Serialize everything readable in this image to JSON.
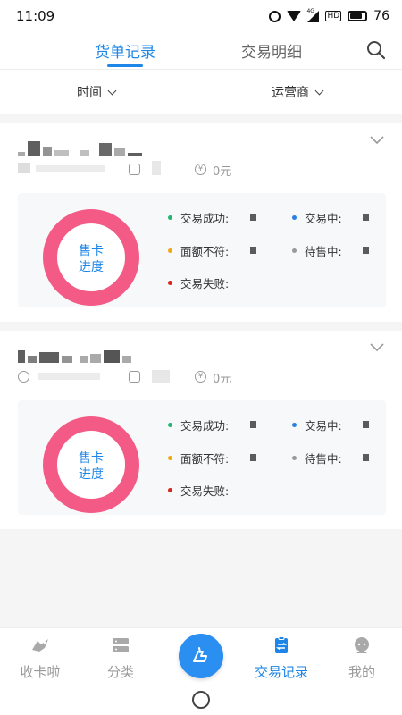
{
  "status_bar": {
    "time": "11:09",
    "network": "4G",
    "battery": "76"
  },
  "tabs": [
    {
      "label": "货单记录",
      "active": true
    },
    {
      "label": "交易明细",
      "active": false
    }
  ],
  "filters": {
    "time_label": "时间",
    "operator_label": "运营商"
  },
  "cards": [
    {
      "amount": "0元",
      "ring_label_line1": "售卡",
      "ring_label_line2": "进度",
      "stats": {
        "success": "交易成功:",
        "in_progress": "交易中:",
        "mismatch": "面额不符:",
        "pending": "待售中:",
        "failed": "交易失败:"
      }
    },
    {
      "amount": "0元",
      "ring_label_line1": "售卡",
      "ring_label_line2": "进度",
      "stats": {
        "success": "交易成功:",
        "in_progress": "交易中:",
        "mismatch": "面额不符:",
        "pending": "待售中:",
        "failed": "交易失败:"
      }
    }
  ],
  "bottom_nav": [
    {
      "label": "收卡啦",
      "icon": "bird-logo-icon",
      "active": false
    },
    {
      "label": "分类",
      "icon": "category-icon",
      "active": false
    },
    {
      "label": "交易记录",
      "icon": "clipboard-exchange-icon",
      "active": true
    },
    {
      "label": "我的",
      "icon": "profile-icon",
      "active": false
    }
  ],
  "colors": {
    "accent": "#1e86e6",
    "ring": "#f35a85",
    "success": "#22b573",
    "in_progress": "#2a7fe0",
    "mismatch": "#f0a814",
    "pending": "#999999",
    "failed": "#d9261c"
  }
}
